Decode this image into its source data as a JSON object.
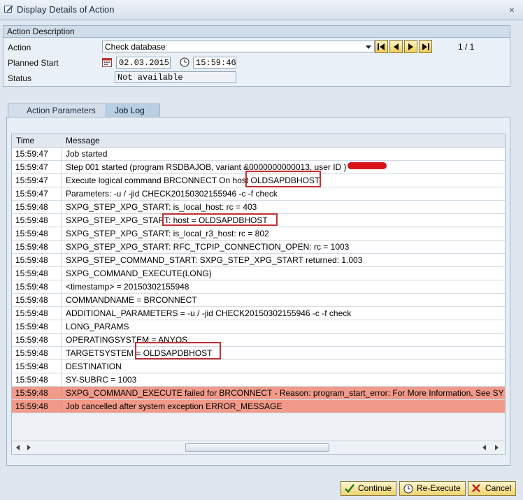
{
  "window": {
    "title": "Display Details of Action",
    "close": "×"
  },
  "group": {
    "title": "Action Description",
    "action_label": "Action",
    "action_value": "Check database",
    "planned_start_label": "Planned Start",
    "planned_date": "02.03.2015",
    "planned_time": "15:59:46",
    "status_label": "Status",
    "status_value": "Not available",
    "pager": "1  /  1"
  },
  "tabs": [
    {
      "label": "Action Parameters",
      "active": false
    },
    {
      "label": "Job Log",
      "active": true
    }
  ],
  "log": {
    "columns": [
      "Time",
      "Message"
    ],
    "rows": [
      {
        "time": "15:59:47",
        "message": "Job started",
        "error": false
      },
      {
        "time": "15:59:47",
        "message": "Step 001 started (program RSDBAJOB, variant &0000000000013, user ID         )",
        "error": false
      },
      {
        "time": "15:59:47",
        "message": "Execute logical command BRCONNECT On host OLDSAPDBHOST",
        "error": false
      },
      {
        "time": "15:59:47",
        "message": "Parameters: -u / -jid CHECK20150302155946 -c -f check",
        "error": false
      },
      {
        "time": "15:59:48",
        "message": "SXPG_STEP_XPG_START: is_local_host: rc = 403",
        "error": false
      },
      {
        "time": "15:59:48",
        "message": "SXPG_STEP_XPG_START: host = OLDSAPDBHOST",
        "error": false
      },
      {
        "time": "15:59:48",
        "message": "SXPG_STEP_XPG_START: is_local_r3_host: rc = 802",
        "error": false
      },
      {
        "time": "15:59:48",
        "message": "SXPG_STEP_XPG_START: RFC_TCPIP_CONNECTION_OPEN: rc = 1003",
        "error": false
      },
      {
        "time": "15:59:48",
        "message": "SXPG_STEP_COMMAND_START: SXPG_STEP_XPG_START returned: 1.003",
        "error": false
      },
      {
        "time": "15:59:48",
        "message": "SXPG_COMMAND_EXECUTE(LONG)",
        "error": false
      },
      {
        "time": "15:59:48",
        "message": "<timestamp> = 20150302155948",
        "error": false
      },
      {
        "time": "15:59:48",
        "message": "COMMANDNAME = BRCONNECT",
        "error": false
      },
      {
        "time": "15:59:48",
        "message": "ADDITIONAL_PARAMETERS = -u / -jid CHECK20150302155946 -c -f check",
        "error": false
      },
      {
        "time": "15:59:48",
        "message": "LONG_PARAMS",
        "error": false
      },
      {
        "time": "15:59:48",
        "message": "OPERATINGSYSTEM = ANYOS",
        "error": false
      },
      {
        "time": "15:59:48",
        "message": "TARGETSYSTEM = OLDSAPDBHOST",
        "error": false
      },
      {
        "time": "15:59:48",
        "message": "DESTINATION",
        "error": false
      },
      {
        "time": "15:59:48",
        "message": "SY-SUBRC = 1003",
        "error": false
      },
      {
        "time": "15:59:48",
        "message": "SXPG_COMMAND_EXECUTE failed for BRCONNECT - Reason: program_start_error: For More Information, See SYS",
        "error": true
      },
      {
        "time": "15:59:48",
        "message": "Job cancelled after system exception ERROR_MESSAGE",
        "error": true
      }
    ]
  },
  "buttons": {
    "continue": "Continue",
    "reexecute": "Re-Execute",
    "cancel": "Cancel"
  },
  "colors": {
    "error_row": "#f29a8a",
    "highlight_box": "#c2312f",
    "button_bg": "#f0d36a"
  }
}
